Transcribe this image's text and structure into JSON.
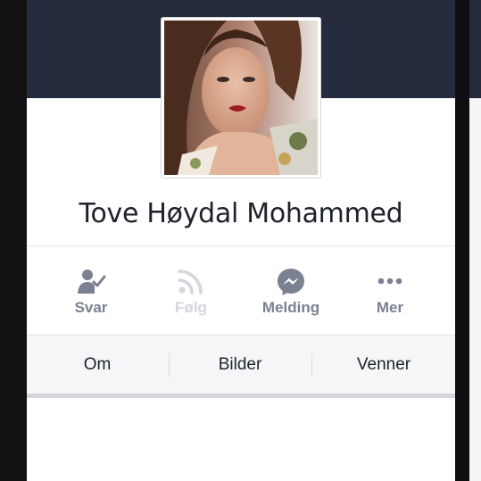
{
  "profile": {
    "name": "Tove Høydal Mohammed"
  },
  "actions": [
    {
      "label": "Svar",
      "icon": "friend-request-respond-icon",
      "enabled": true
    },
    {
      "label": "Følg",
      "icon": "rss-follow-icon",
      "enabled": false
    },
    {
      "label": "Melding",
      "icon": "messenger-icon",
      "enabled": true
    },
    {
      "label": "Mer",
      "icon": "more-dots-icon",
      "enabled": true
    }
  ],
  "tabs": [
    {
      "label": "Om"
    },
    {
      "label": "Bilder"
    },
    {
      "label": "Venner"
    }
  ],
  "colors": {
    "cover": "#262c3d",
    "action_icon": "#7b8190",
    "action_disabled": "#d3d6dc",
    "tab_bar": "#f5f6f8",
    "text": "#1d2129"
  }
}
